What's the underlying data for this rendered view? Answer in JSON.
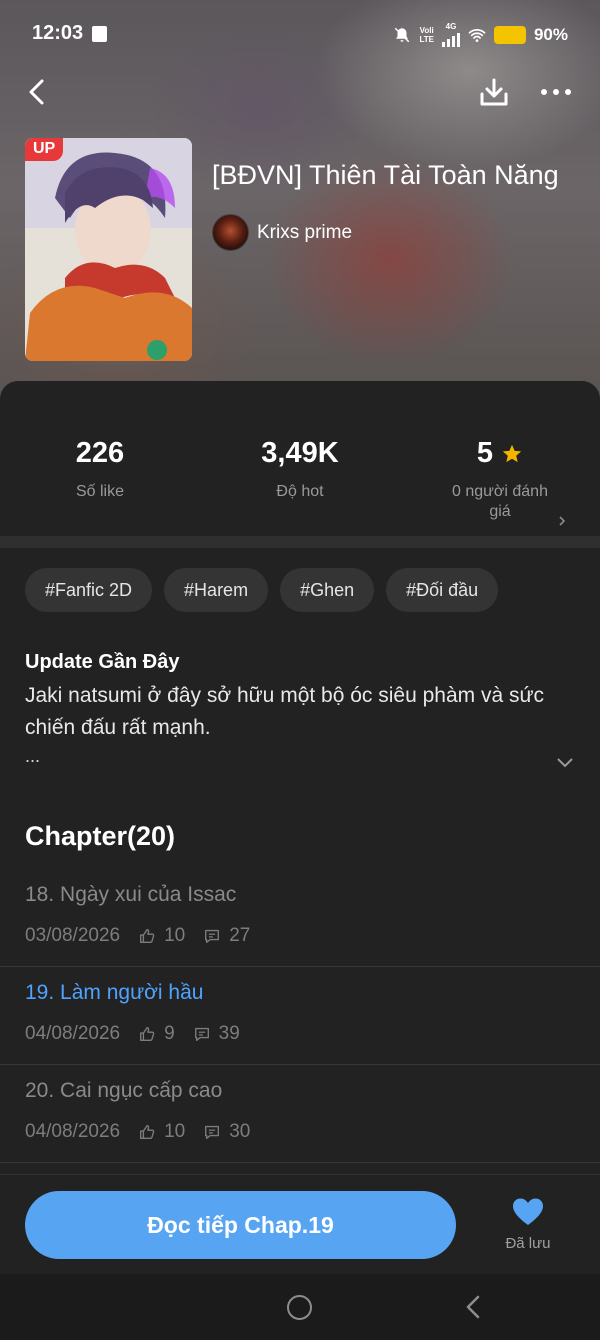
{
  "status_bar": {
    "time": "12:03",
    "network_top": "Voli",
    "network_bottom": "LTE",
    "network_gen": "4G",
    "battery": "90%"
  },
  "story": {
    "badge": "UP",
    "title": "[BĐVN] Thiên Tài Toàn Năng",
    "author": "Krixs prime"
  },
  "stats": {
    "likes_value": "226",
    "likes_label": "Số like",
    "hot_value": "3,49K",
    "hot_label": "Độ hot",
    "rating_value": "5",
    "rating_label": "0 người đánh giá"
  },
  "tags": [
    "#Fanfic 2D",
    "#Harem",
    "#Ghen",
    "#Đối đầu"
  ],
  "update": {
    "heading": "Update Gần Đây",
    "description": "Jaki natsumi ở đây sở hữu một bộ óc siêu phàm và sức chiến đấu rất mạnh.",
    "ellipsis": "..."
  },
  "chapters": {
    "heading": "Chapter(20)",
    "items": [
      {
        "title": "18. Ngày xui của Issac",
        "date": "03/08/2026",
        "likes": "10",
        "comments": "27",
        "current": false
      },
      {
        "title": "19. Làm người hầu",
        "date": "04/08/2026",
        "likes": "9",
        "comments": "39",
        "current": true
      },
      {
        "title": "20. Cai ngục cấp cao",
        "date": "04/08/2026",
        "likes": "10",
        "comments": "30",
        "current": false
      }
    ]
  },
  "actions": {
    "read_label": "Đọc tiếp Chap.19",
    "saved_label": "Đã lưu"
  },
  "colors": {
    "accent": "#57a5f2",
    "current_chapter": "#4fa3ff",
    "star": "#f5b400",
    "badge": "#e8393a"
  },
  "icons": [
    "back-icon",
    "download-icon",
    "more-icon",
    "star-icon",
    "chevron-right-icon",
    "chevron-down-icon",
    "thumbs-up-icon",
    "comment-icon",
    "heart-icon",
    "home-icon"
  ]
}
